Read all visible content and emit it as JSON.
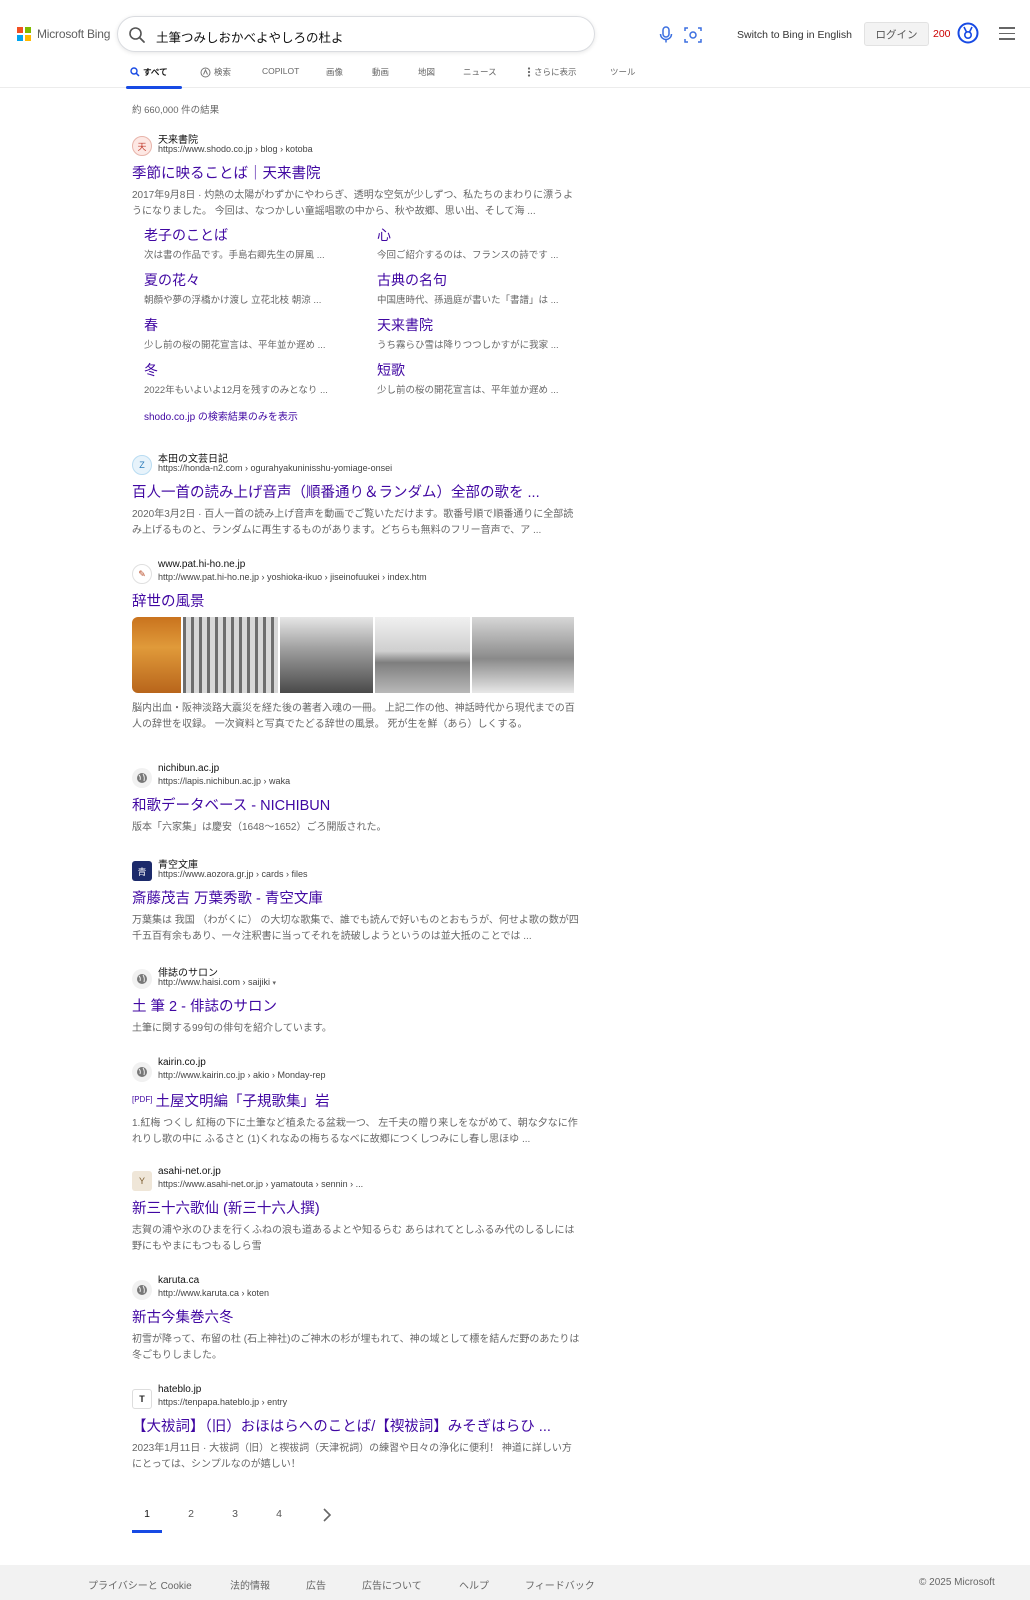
{
  "header": {
    "logo_text": "Microsoft Bing",
    "ms_colors": [
      "#f25022",
      "#7fba00",
      "#00a4ef",
      "#ffb900"
    ],
    "query": "土筆つみしおかべよやしろの杜よ",
    "switch_lang": "Switch to Bing in English",
    "login": "ログイン",
    "points": "200"
  },
  "tabs": [
    {
      "label": "すべて",
      "icon": "search-icon"
    },
    {
      "label": "検索",
      "icon": "copilot-icon"
    },
    {
      "label": "COPILOT"
    },
    {
      "label": "画像"
    },
    {
      "label": "動画"
    },
    {
      "label": "地図"
    },
    {
      "label": "ニュース"
    },
    {
      "label": "さらに表示",
      "icon": "more-vertical-icon"
    },
    {
      "label": "ツール"
    }
  ],
  "result_count": "約 660,000 件の結果",
  "results": [
    {
      "site": "天来書院",
      "url": "https://www.shodo.co.jp › blog › kotoba",
      "title": "季節に映ることば｜天来書院",
      "snippet": "2017年9月8日 · 灼熱の太陽がわずかにやわらぎ、透明な空気が少しずつ、私たちのまわりに漂うようになりました。 今回は、なつかしい童謡唱歌の中から、秋や故郷、思い出、そして海 ...",
      "favicon": "天",
      "deeplinks": [
        {
          "title": "老子のことば",
          "snippet": "次は書の作品です。手島右卿先生の屏風 ..."
        },
        {
          "title": "心",
          "snippet": "今回ご紹介するのは、フランスの詩です ..."
        },
        {
          "title": "夏の花々",
          "snippet": "朝顔や夢の浮橋かけ渡し 立花北枝 朝涼 ..."
        },
        {
          "title": "古典の名句",
          "snippet": "中国唐時代、孫過庭が書いた「書譜」は ..."
        },
        {
          "title": "春",
          "snippet": "少し前の桜の開花宣言は、平年並か遅め ..."
        },
        {
          "title": "天来書院",
          "snippet": "うち霧らひ雪は降りつつしかすがに我家 ..."
        },
        {
          "title": "冬",
          "snippet": "2022年もいよいよ12月を残すのみとなり ..."
        },
        {
          "title": "短歌",
          "snippet": "少し前の桜の開花宣言は、平年並か遅め ..."
        }
      ],
      "more_from_site": "shodo.co.jp の検索結果のみを表示"
    },
    {
      "site": "本田の文芸日記",
      "url": "https://honda-n2.com › ogurahyakuninisshu-yomiage-onsei",
      "title": "百人一首の読み上げ音声（順番通り＆ランダム）全部の歌を ...",
      "snippet": "2020年3月2日 · 百人一首の読み上げ音声を動画でご覧いただけます。歌番号順で順番通りに全部読み上げるものと、ランダムに再生するものがあります。どちらも無料のフリー音声で、ア ...",
      "favicon": "Z"
    },
    {
      "site": "www.pat.hi-ho.ne.jp",
      "url": "http://www.pat.hi-ho.ne.jp › yoshioka-ikuo › jiseinofuukei › index.htm",
      "title": "辞世の風景",
      "snippet": "脳内出血・阪神淡路大震災を経た後の著者入魂の一冊。 上記二作の他、神話時代から現代までの百人の辞世を収録。 一次資料と写真でたどる辞世の風景。 死が生を鮮（あら）しくする。",
      "favicon": "✎"
    },
    {
      "site": "nichibun.ac.jp",
      "url": "https://lapis.nichibun.ac.jp › waka",
      "title": "和歌データベース - NICHIBUN",
      "snippet": "版本「六家集」は慶安（1648〜1652）ごろ開版された。",
      "favicon": "globe"
    },
    {
      "site": "青空文庫",
      "url": "https://www.aozora.gr.jp › cards › files",
      "title": "斎藤茂吉 万葉秀歌 - 青空文庫",
      "snippet": "万葉集は 我国 （わがくに） の大切な歌集で、誰でも読んで好いものとおもうが、何せよ歌の数が四千五百有余もあり、一々注釈書に当ってそれを読破しようというのは並大抵のことでは ...",
      "favicon": "青"
    },
    {
      "site": "俳誌のサロン",
      "url": "http://www.haisi.com › saijiki",
      "title": "土 筆 2 - 俳誌のサロン",
      "snippet": "土筆に関する99句の俳句を紹介しています。",
      "favicon": "globe"
    },
    {
      "site": "kairin.co.jp",
      "url": "http://www.kairin.co.jp › akio › Monday-rep",
      "pdf": "[PDF]",
      "title": "土屋文明編「子規歌集」岩",
      "snippet": "1.紅梅 つくし 紅梅の下に土筆など植ゑたる盆栽一つ、 左千夫の贈り来しをながめて、朝な夕なに作れりし歌の中に ふるさと (1)くれなゐの梅ちるなべに故郷につくしつみにし春し思ほゆ ...",
      "favicon": "globe"
    },
    {
      "site": "asahi-net.or.jp",
      "url": "https://www.asahi-net.or.jp › yamatouta › sennin › ...",
      "title": "新三十六歌仙 (新三十六人撰)",
      "snippet": "志賀の浦や氷のひまを行くふねの浪も道あるよとや知るらむ あらはれてとしふるみ代のしるしには野にもやまにもつもるしら雪",
      "favicon": "Y"
    },
    {
      "site": "karuta.ca",
      "url": "http://www.karuta.ca › koten",
      "title": "新古今集巻六冬",
      "snippet": "初雪が降って、布留の杜 (石上神社)のご神木の杉が埋もれて、神の域として標を結んだ野のあたりは冬ごもりしました。",
      "favicon": "globe"
    },
    {
      "site": "hateblo.jp",
      "url": "https://tenpapa.hateblo.jp › entry",
      "title": "【大祓詞】（旧）おほはらへのことば/【禊祓詞】みそぎはらひ ...",
      "snippet": "2023年1月11日 · 大祓詞（旧）と禊祓詞（天津祝詞）の練習や日々の浄化に便利！ 神道に詳しい方にとっては、シンプルなのが嬉しい！",
      "favicon": "T"
    }
  ],
  "pagination": {
    "pages": [
      "1",
      "2",
      "3",
      "4"
    ],
    "current": "1"
  },
  "footer": {
    "links": [
      "プライバシーと Cookie",
      "法的情報",
      "広告",
      "広告について",
      "ヘルプ",
      "フィードバック"
    ],
    "copyright": "© 2025 Microsoft"
  },
  "colors": {
    "link": "#4007a2",
    "accent": "#174ae4",
    "points": "#cc0000"
  }
}
